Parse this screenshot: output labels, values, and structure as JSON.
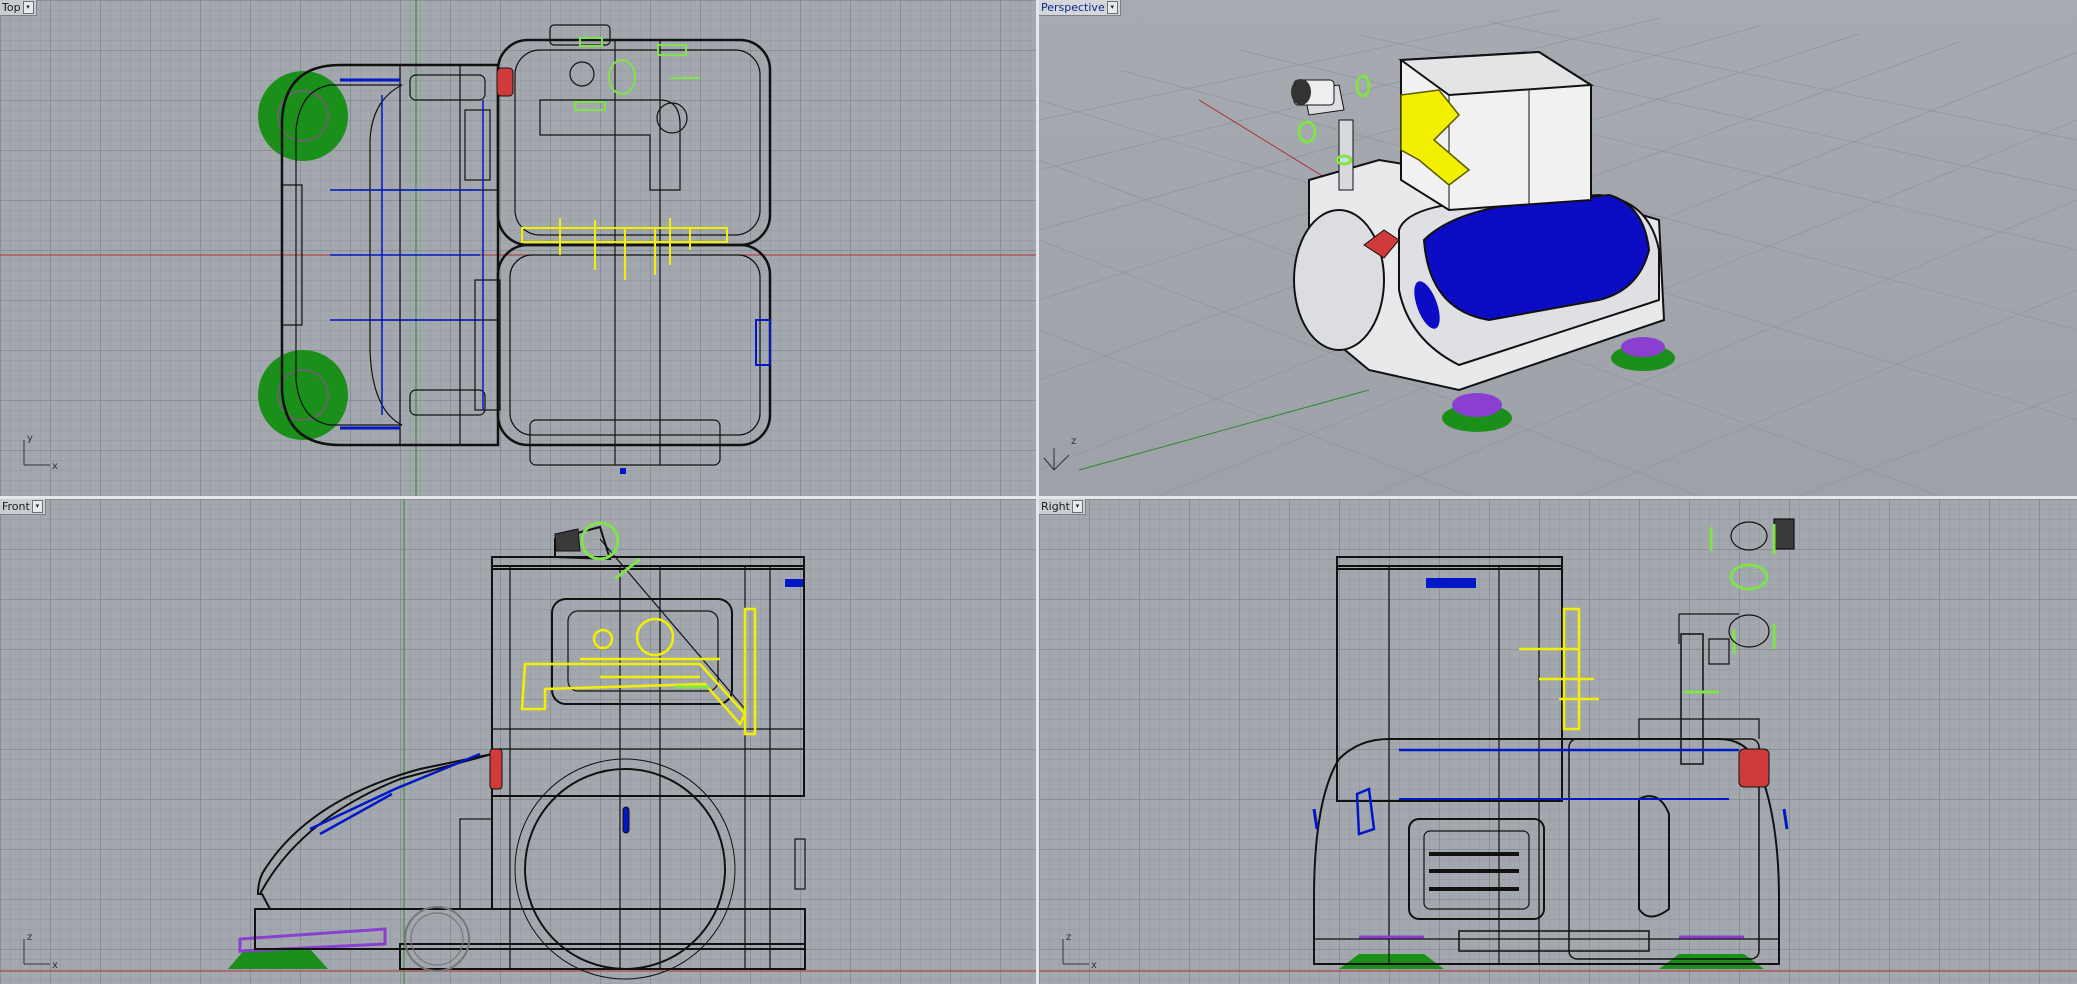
{
  "viewports": {
    "top": {
      "label": "Top",
      "axis_v": "y",
      "axis_h": "x"
    },
    "persp": {
      "label": "Perspective",
      "axis_v": "z"
    },
    "front": {
      "label": "Front",
      "axis_v": "z",
      "axis_h": "x"
    },
    "right": {
      "label": "Right",
      "axis_v": "z",
      "axis_h": "x"
    }
  },
  "colors": {
    "grid_bg": "#a3a8ae",
    "x_axis": "#b03030",
    "y_axis": "#2d8a2d",
    "wireframe": "#111111",
    "highlight_blue": "#0018c8",
    "highlight_yellow": "#f2ef00",
    "highlight_green": "#19b80f",
    "light_green": "#7fe34a",
    "purple": "#8a3fd0",
    "red": "#d03a3a"
  },
  "icons": {
    "dropdown": "chevron-down-icon",
    "axis_widget": "axis-triad-icon"
  }
}
